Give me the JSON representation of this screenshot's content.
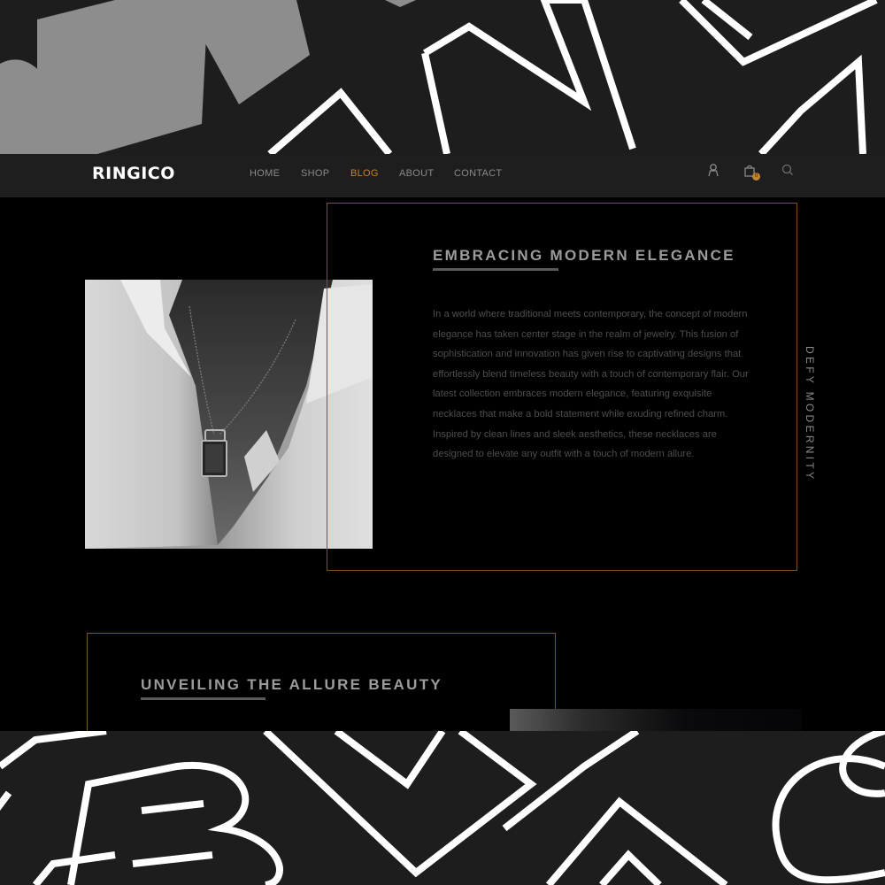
{
  "brand": {
    "logo": "RINGICO",
    "accent_color": "#c4832f"
  },
  "nav": {
    "items": [
      {
        "label": "HOME",
        "active": false
      },
      {
        "label": "SHOP",
        "active": false
      },
      {
        "label": "BLOG",
        "active": true
      },
      {
        "label": "ABOUT",
        "active": false
      },
      {
        "label": "CONTACT",
        "active": false
      }
    ],
    "icons": [
      "user-icon",
      "shopping-bag-icon",
      "search-icon"
    ],
    "cart_count": "0"
  },
  "section1": {
    "title": "EMBRACING MODERN ELEGANCE",
    "body": "In a world where traditional meets contemporary, the concept of modern elegance has taken center stage in the realm of jewelry. This fusion of sophistication and innovation has given rise to captivating designs that effortlessly blend timeless beauty with a touch of contemporary flair. Our latest collection embraces modern elegance, featuring exquisite necklaces that make a bold statement while exuding refined charm. Inspired by clean lines and sleek aesthetics, these necklaces are designed to elevate any outfit with a touch of modern allure.",
    "side_text": "DEFY MODERNITY",
    "image": "man-in-white-shirt-wearing-pendant-necklace"
  },
  "section2": {
    "title": "UNVEILING THE ALLURE BEAUTY"
  }
}
